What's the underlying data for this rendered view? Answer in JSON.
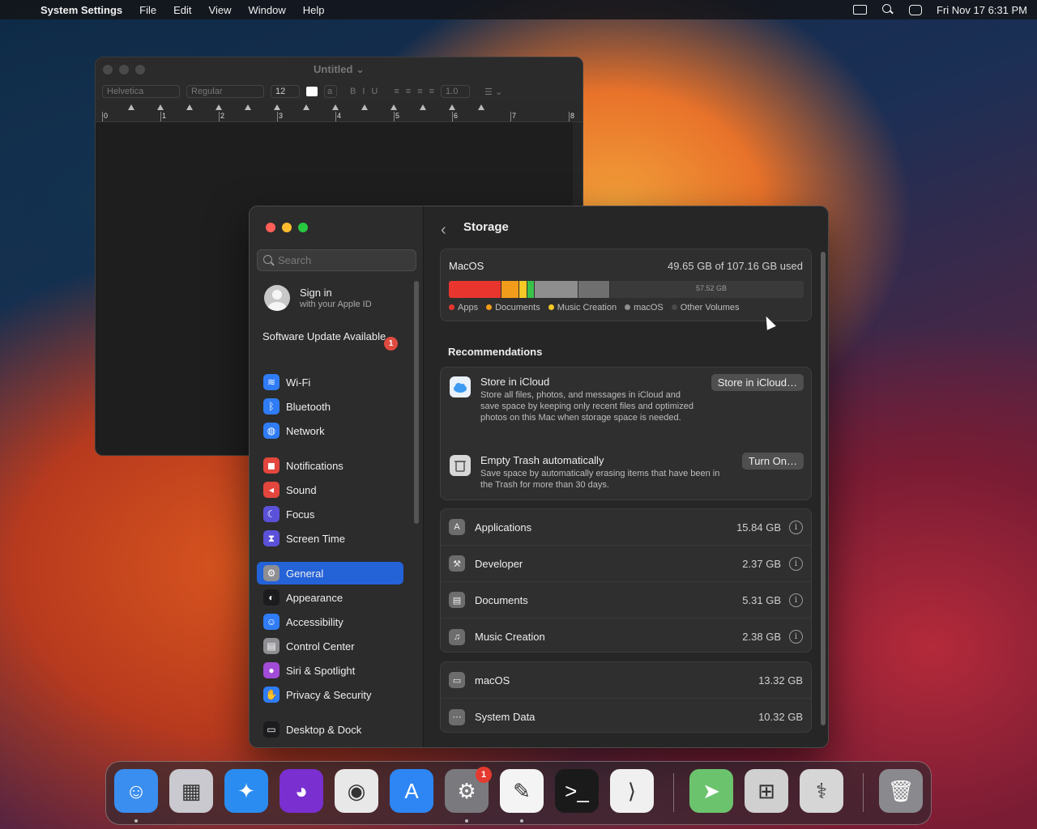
{
  "menubar": {
    "app_name": "System Settings",
    "menus": [
      "File",
      "Edit",
      "View",
      "Window",
      "Help"
    ],
    "clock": "Fri Nov 17  6:31 PM"
  },
  "textedit": {
    "title": "Untitled",
    "font": "Helvetica",
    "style": "Regular",
    "size": "12",
    "spacing": "1.0",
    "bold": "B",
    "italic": "I",
    "underline": "U",
    "ruler_numbers": [
      "0",
      "1",
      "2",
      "3",
      "4",
      "5",
      "6",
      "7",
      "8"
    ]
  },
  "sidebar": {
    "search_placeholder": "Search",
    "signin_title": "Sign in",
    "signin_sub": "with your Apple ID",
    "update_label": "Software Update Available",
    "update_badge": "1",
    "items": [
      {
        "label": "Wi-Fi",
        "color": "#2f7cf6",
        "glyph": "≋"
      },
      {
        "label": "Bluetooth",
        "color": "#2f7cf6",
        "glyph": "ᛒ"
      },
      {
        "label": "Network",
        "color": "#2f7cf6",
        "glyph": "◍"
      },
      {
        "label": "Notifications",
        "color": "#e2463d",
        "glyph": "◼"
      },
      {
        "label": "Sound",
        "color": "#e2463d",
        "glyph": "◂"
      },
      {
        "label": "Focus",
        "color": "#5b51d8",
        "glyph": "☾"
      },
      {
        "label": "Screen Time",
        "color": "#5b51d8",
        "glyph": "⧗"
      },
      {
        "label": "General",
        "color": "#8e8e93",
        "glyph": "⚙"
      },
      {
        "label": "Appearance",
        "color": "#1c1c1e",
        "glyph": "◐"
      },
      {
        "label": "Accessibility",
        "color": "#2f7cf6",
        "glyph": "☺"
      },
      {
        "label": "Control Center",
        "color": "#8e8e93",
        "glyph": "▤"
      },
      {
        "label": "Siri & Spotlight",
        "color": "#a24bd6",
        "glyph": "●"
      },
      {
        "label": "Privacy & Security",
        "color": "#2f7cf6",
        "glyph": "✋"
      },
      {
        "label": "Desktop & Dock",
        "color": "#1c1c1e",
        "glyph": "▭"
      }
    ]
  },
  "main": {
    "title": "Storage",
    "disk": {
      "name": "MacOS",
      "used": "49.65 GB of 107.16 GB used",
      "free_label": "57.52 GB",
      "segments": [
        {
          "name": "Apps",
          "color": "#e8362f",
          "fraction": 0.148
        },
        {
          "name": "Documents",
          "color": "#f19d1b",
          "fraction": 0.05
        },
        {
          "name": "Music Creation",
          "color": "#f7c926",
          "fraction": 0.022
        },
        {
          "name": "Music Creation 2",
          "color": "#39c14a",
          "fraction": 0.02
        },
        {
          "name": "Developer",
          "color": "#8e8e8e",
          "fraction": 0.124
        },
        {
          "name": "macOS",
          "color": "#6f6f6f",
          "fraction": 0.09
        }
      ],
      "legend": [
        {
          "label": "Apps",
          "color": "#e8362f"
        },
        {
          "label": "Documents",
          "color": "#f19d1b"
        },
        {
          "label": "Music Creation",
          "color": "#f7c926"
        },
        {
          "label": "macOS",
          "color": "#8e8e8e"
        },
        {
          "label": "Other Volumes",
          "color": "#4a4a4a"
        }
      ]
    },
    "recommendations_heading": "Recommendations",
    "recs": [
      {
        "title": "Store in iCloud",
        "desc": "Store all files, photos, and messages in iCloud and save space by keeping only recent files and optimized photos on this Mac when storage space is needed.",
        "button": "Store in iCloud…"
      },
      {
        "title": "Empty Trash automatically",
        "desc": "Save space by automatically erasing items that have been in the Trash for more than 30 days.",
        "button": "Turn On…"
      }
    ],
    "categories": [
      {
        "label": "Applications",
        "size": "15.84 GB",
        "glyph": "A"
      },
      {
        "label": "Developer",
        "size": "2.37 GB",
        "glyph": "⚒"
      },
      {
        "label": "Documents",
        "size": "5.31 GB",
        "glyph": "▤"
      },
      {
        "label": "Music Creation",
        "size": "2.38 GB",
        "glyph": "♫"
      }
    ],
    "system": [
      {
        "label": "macOS",
        "size": "13.32 GB",
        "glyph": "▭"
      },
      {
        "label": "System Data",
        "size": "10.32 GB",
        "glyph": "⋯"
      }
    ]
  },
  "dock": {
    "settings_badge": "1",
    "apps": [
      {
        "name": "finder-icon",
        "color": "#3a8ef0",
        "glyph": "☺"
      },
      {
        "name": "launchpad-icon",
        "color": "#c9c9cf",
        "glyph": "▦"
      },
      {
        "name": "safari-icon",
        "color": "#2a8cf0",
        "glyph": "✦"
      },
      {
        "name": "firefox-icon",
        "color": "#7a2fd0",
        "glyph": "◕"
      },
      {
        "name": "chrome-icon",
        "color": "#e8e8e8",
        "glyph": "◉"
      },
      {
        "name": "app-store-icon",
        "color": "#2d86f3",
        "glyph": "A"
      },
      {
        "name": "system-settings-icon",
        "color": "#7a7a7e",
        "glyph": "⚙"
      },
      {
        "name": "textedit-icon",
        "color": "#f4f4f4",
        "glyph": "✎"
      },
      {
        "name": "terminal-icon",
        "color": "#1a1a1a",
        "glyph": ">_"
      },
      {
        "name": "vscode-icon",
        "color": "#f0f0f0",
        "glyph": "⟩"
      },
      {
        "name": "maps-icon",
        "color": "#6cc36e",
        "glyph": "➤"
      },
      {
        "name": "boot-camp-icon",
        "color": "#d0d0d0",
        "glyph": "⊞"
      },
      {
        "name": "disk-utility-icon",
        "color": "#d6d6d6",
        "glyph": "⚕"
      },
      {
        "name": "trash-icon",
        "color": "#8a8a8e",
        "glyph": "🗑"
      }
    ]
  }
}
